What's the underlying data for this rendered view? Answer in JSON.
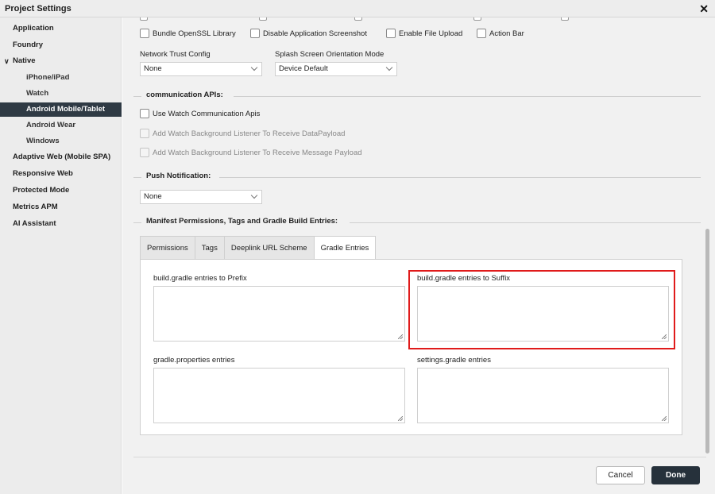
{
  "window": {
    "title": "Project Settings",
    "close_glyph": "✕"
  },
  "sidebar": {
    "items": [
      {
        "label": "Application"
      },
      {
        "label": "Foundry"
      },
      {
        "label": "Native",
        "expanded": true
      },
      {
        "label": "iPhone/iPad"
      },
      {
        "label": "Watch"
      },
      {
        "label": "Android Mobile/Tablet",
        "selected": true
      },
      {
        "label": "Android Wear"
      },
      {
        "label": "Windows"
      },
      {
        "label": "Adaptive Web (Mobile SPA)"
      },
      {
        "label": "Responsive Web"
      },
      {
        "label": "Protected Mode"
      },
      {
        "label": "Metrics APM"
      },
      {
        "label": "AI Assistant"
      }
    ]
  },
  "options": {
    "bundle_openssl": "Bundle OpenSSL Library",
    "disable_screenshot": "Disable Application Screenshot",
    "enable_file_upload": "Enable File Upload",
    "action_bar": "Action Bar"
  },
  "network": {
    "label": "Network Trust Config",
    "value": "None"
  },
  "splash": {
    "label": "Splash Screen Orientation Mode",
    "value": "Device Default"
  },
  "communication": {
    "heading": "communication APIs:",
    "use_watch": "Use Watch Communication Apis",
    "bg_data": "Add Watch Background Listener To Receive DataPayload",
    "bg_message": "Add Watch Background Listener To Receive Message Payload"
  },
  "push": {
    "heading": "Push Notification:",
    "value": "None"
  },
  "manifest": {
    "heading": "Manifest Permissions, Tags and Gradle Build Entries:",
    "tabs": [
      {
        "label": "Permissions"
      },
      {
        "label": "Tags"
      },
      {
        "label": "Deeplink URL Scheme"
      },
      {
        "label": "Gradle Entries",
        "active": true
      }
    ],
    "gradle": {
      "prefix_label": "build.gradle entries to Prefix",
      "suffix_label": "build.gradle entries to Suffix",
      "properties_label": "gradle.properties entries",
      "settings_label": "settings.gradle entries",
      "prefix_value": "",
      "suffix_value": "",
      "properties_value": "",
      "settings_value": ""
    }
  },
  "footer": {
    "cancel": "Cancel",
    "done": "Done"
  },
  "colors": {
    "highlight": "#e01b1b",
    "selected_bg": "#2f3a44",
    "done_bg": "#26313b"
  }
}
